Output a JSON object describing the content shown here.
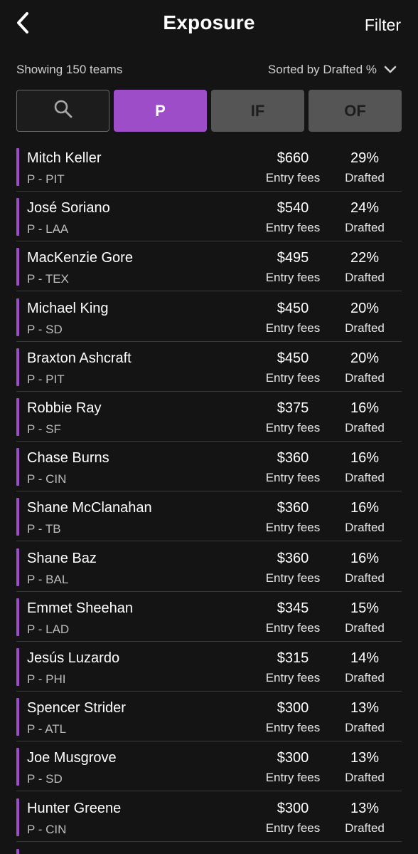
{
  "header": {
    "title": "Exposure",
    "filter_label": "Filter"
  },
  "subbar": {
    "showing": "Showing 150 teams",
    "sorted": "Sorted by Drafted %"
  },
  "tabs": [
    {
      "label": "",
      "icon": "search-icon",
      "active": false
    },
    {
      "label": "P",
      "active": true
    },
    {
      "label": "IF",
      "active": false
    },
    {
      "label": "OF",
      "active": false
    }
  ],
  "colors": {
    "accent": "#9d4dc7",
    "background": "#141414",
    "inactive_tab": "#555555"
  },
  "players": [
    {
      "name": "Mitch Keller",
      "pos": "P - PIT",
      "fee": "$660",
      "fee_label": "Entry fees",
      "pct": "29%",
      "pct_label": "Drafted"
    },
    {
      "name": "José Soriano",
      "pos": "P - LAA",
      "fee": "$540",
      "fee_label": "Entry fees",
      "pct": "24%",
      "pct_label": "Drafted"
    },
    {
      "name": "MacKenzie Gore",
      "pos": "P - TEX",
      "fee": "$495",
      "fee_label": "Entry fees",
      "pct": "22%",
      "pct_label": "Drafted"
    },
    {
      "name": "Michael King",
      "pos": "P - SD",
      "fee": "$450",
      "fee_label": "Entry fees",
      "pct": "20%",
      "pct_label": "Drafted"
    },
    {
      "name": "Braxton Ashcraft",
      "pos": "P - PIT",
      "fee": "$450",
      "fee_label": "Entry fees",
      "pct": "20%",
      "pct_label": "Drafted"
    },
    {
      "name": "Robbie Ray",
      "pos": "P - SF",
      "fee": "$375",
      "fee_label": "Entry fees",
      "pct": "16%",
      "pct_label": "Drafted"
    },
    {
      "name": "Chase Burns",
      "pos": "P - CIN",
      "fee": "$360",
      "fee_label": "Entry fees",
      "pct": "16%",
      "pct_label": "Drafted"
    },
    {
      "name": "Shane McClanahan",
      "pos": "P - TB",
      "fee": "$360",
      "fee_label": "Entry fees",
      "pct": "16%",
      "pct_label": "Drafted"
    },
    {
      "name": "Shane Baz",
      "pos": "P - BAL",
      "fee": "$360",
      "fee_label": "Entry fees",
      "pct": "16%",
      "pct_label": "Drafted"
    },
    {
      "name": "Emmet Sheehan",
      "pos": "P - LAD",
      "fee": "$345",
      "fee_label": "Entry fees",
      "pct": "15%",
      "pct_label": "Drafted"
    },
    {
      "name": "Jesús Luzardo",
      "pos": "P - PHI",
      "fee": "$315",
      "fee_label": "Entry fees",
      "pct": "14%",
      "pct_label": "Drafted"
    },
    {
      "name": "Spencer Strider",
      "pos": "P - ATL",
      "fee": "$300",
      "fee_label": "Entry fees",
      "pct": "13%",
      "pct_label": "Drafted"
    },
    {
      "name": "Joe Musgrove",
      "pos": "P - SD",
      "fee": "$300",
      "fee_label": "Entry fees",
      "pct": "13%",
      "pct_label": "Drafted"
    },
    {
      "name": "Hunter Greene",
      "pos": "P - CIN",
      "fee": "$300",
      "fee_label": "Entry fees",
      "pct": "13%",
      "pct_label": "Drafted"
    }
  ]
}
